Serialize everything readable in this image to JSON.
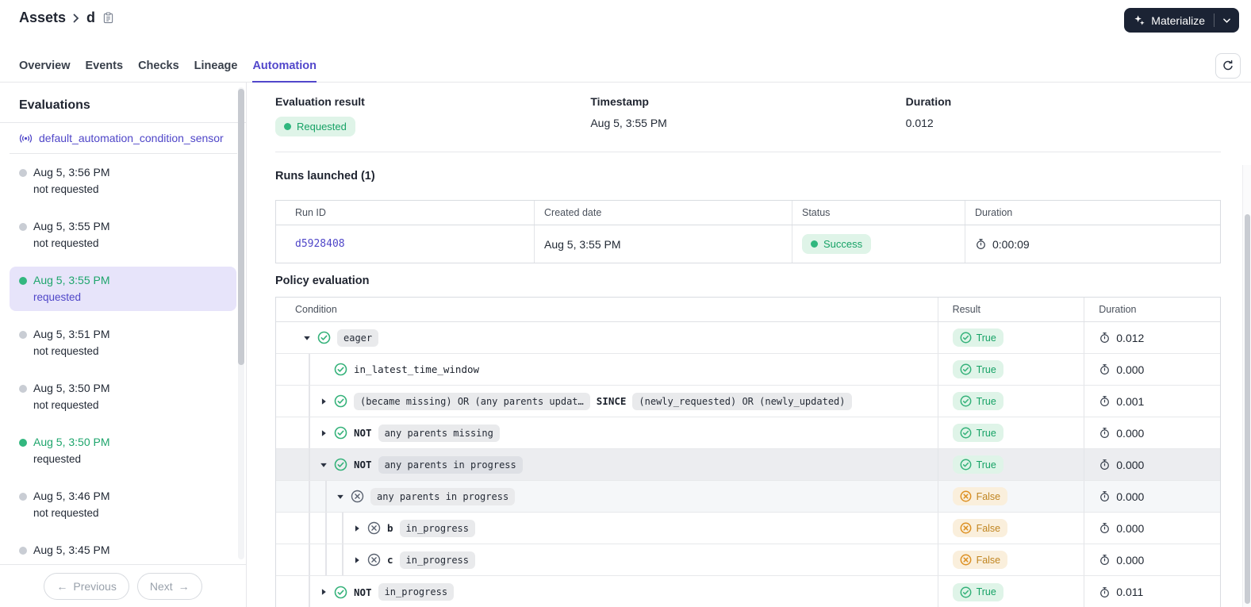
{
  "colors": {
    "accent": "#4F46C8",
    "green": "#1EA56C",
    "green_bg": "#DFF4E8",
    "orange": "#C08521",
    "orange_bg": "#FAEFDC",
    "navy_button": "#1B2334",
    "selected_item_bg": "#E7E4FA"
  },
  "header": {
    "breadcrumb_root": "Assets",
    "breadcrumb_current": "d",
    "materialize_label": "Materialize"
  },
  "tabs": [
    {
      "label": "Overview",
      "active": false
    },
    {
      "label": "Events",
      "active": false
    },
    {
      "label": "Checks",
      "active": false
    },
    {
      "label": "Lineage",
      "active": false
    },
    {
      "label": "Automation",
      "active": true
    }
  ],
  "sidebar": {
    "title": "Evaluations",
    "sensor": "default_automation_condition_sensor",
    "evaluations": [
      {
        "time": "Aug 5, 3:56 PM",
        "status": "not requested",
        "requested": false,
        "selected": false
      },
      {
        "time": "Aug 5, 3:55 PM",
        "status": "not requested",
        "requested": false,
        "selected": false
      },
      {
        "time": "Aug 5, 3:55 PM",
        "status": "requested",
        "requested": true,
        "selected": true
      },
      {
        "time": "Aug 5, 3:51 PM",
        "status": "not requested",
        "requested": false,
        "selected": false
      },
      {
        "time": "Aug 5, 3:50 PM",
        "status": "not requested",
        "requested": false,
        "selected": false
      },
      {
        "time": "Aug 5, 3:50 PM",
        "status": "requested",
        "requested": true,
        "selected": false
      },
      {
        "time": "Aug 5, 3:46 PM",
        "status": "not requested",
        "requested": false,
        "selected": false
      },
      {
        "time": "Aug 5, 3:45 PM",
        "status": "",
        "requested": false,
        "selected": false
      }
    ],
    "prev_label": "Previous",
    "next_label": "Next",
    "prev_arrow": "←",
    "next_arrow": "→"
  },
  "summary": {
    "result_label": "Evaluation result",
    "result_value": "Requested",
    "timestamp_label": "Timestamp",
    "timestamp_value": "Aug 5, 3:55 PM",
    "duration_label": "Duration",
    "duration_value": "0.012"
  },
  "runs": {
    "title": "Runs launched (1)",
    "columns": [
      "Run ID",
      "Created date",
      "Status",
      "Duration"
    ],
    "rows": [
      {
        "run_id": "d5928408",
        "created": "Aug 5, 3:55 PM",
        "status": "Success",
        "duration": "0:00:09"
      }
    ]
  },
  "policy": {
    "title": "Policy evaluation",
    "columns": [
      "Condition",
      "Result",
      "Duration"
    ],
    "rows": [
      {
        "indent": 0,
        "caret": "down",
        "icon": "check",
        "segments": [
          {
            "type": "chip",
            "text": "eager"
          }
        ],
        "result": "True",
        "duration": "0.012",
        "highlight": ""
      },
      {
        "indent": 1,
        "caret": "",
        "icon": "check",
        "segments": [
          {
            "type": "plain",
            "text": "in_latest_time_window"
          }
        ],
        "result": "True",
        "duration": "0.000",
        "highlight": ""
      },
      {
        "indent": 1,
        "caret": "right",
        "icon": "check",
        "segments": [
          {
            "type": "chip",
            "text": "(became missing) OR (any parents updat…"
          },
          {
            "type": "op",
            "text": "SINCE"
          },
          {
            "type": "chip",
            "text": "(newly_requested) OR (newly_updated)"
          }
        ],
        "result": "True",
        "duration": "0.001",
        "highlight": ""
      },
      {
        "indent": 1,
        "caret": "right",
        "icon": "check",
        "segments": [
          {
            "type": "op",
            "text": "NOT"
          },
          {
            "type": "chip",
            "text": "any parents missing"
          }
        ],
        "result": "True",
        "duration": "0.000",
        "highlight": ""
      },
      {
        "indent": 1,
        "caret": "down",
        "icon": "check",
        "segments": [
          {
            "type": "op",
            "text": "NOT"
          },
          {
            "type": "chip",
            "text": "any parents in progress"
          }
        ],
        "result": "True",
        "duration": "0.000",
        "highlight": "strong"
      },
      {
        "indent": 2,
        "caret": "down",
        "icon": "x",
        "segments": [
          {
            "type": "chip",
            "text": "any parents in progress"
          }
        ],
        "result": "False",
        "duration": "0.000",
        "highlight": "soft"
      },
      {
        "indent": 3,
        "caret": "right",
        "icon": "x",
        "segments": [
          {
            "type": "op",
            "text": "b"
          },
          {
            "type": "chip",
            "text": "in_progress"
          }
        ],
        "result": "False",
        "duration": "0.000",
        "highlight": ""
      },
      {
        "indent": 3,
        "caret": "right",
        "icon": "x",
        "segments": [
          {
            "type": "op",
            "text": "c"
          },
          {
            "type": "chip",
            "text": "in_progress"
          }
        ],
        "result": "False",
        "duration": "0.000",
        "highlight": ""
      },
      {
        "indent": 1,
        "caret": "right",
        "icon": "check",
        "segments": [
          {
            "type": "op",
            "text": "NOT"
          },
          {
            "type": "chip",
            "text": "in_progress"
          }
        ],
        "result": "True",
        "duration": "0.011",
        "highlight": ""
      }
    ]
  }
}
